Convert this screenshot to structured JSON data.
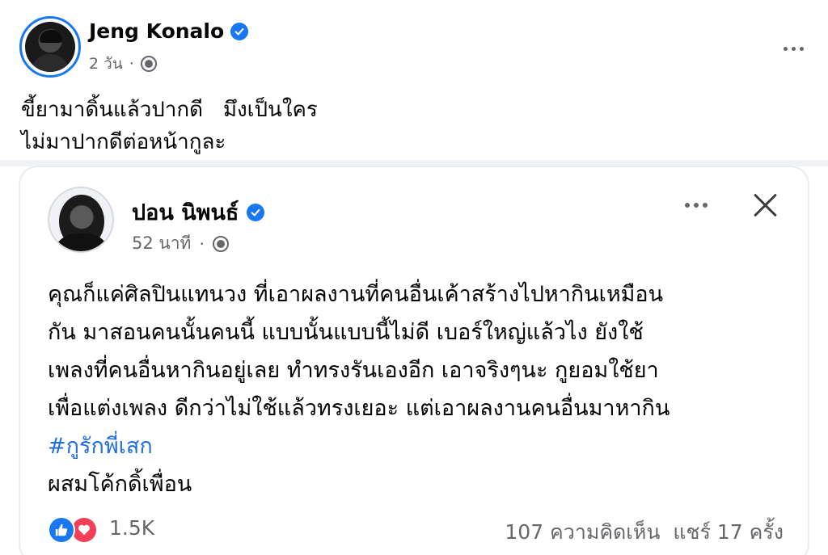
{
  "outer_post": {
    "author": "Jeng Konalo",
    "time": "2 วัน",
    "text_line1": "ขี้ยามาดิ้นแล้วปากดี   มึงเป็นใคร",
    "text_line2": "ไม่มาปากดีต่อหน้ากูละ",
    "icons": [
      "verified-badge-icon",
      "globe-icon",
      "more-options-icon"
    ]
  },
  "shared_post": {
    "author": "ปอน นิพนธ์",
    "time": "52 นาที",
    "body_lines": [
      "คุณก็แค่ศิลปินแทนวง ที่เอาผลงานที่คนอื่นเค้าสร้างไปหากินเหมือน",
      "กัน มาสอนคนนั้นคนนี้ แบบนั้นแบบนี้ไม่ดี เบอร์ใหญ่แล้วไง ยังใช้",
      "เพลงที่คนอื่นหากินอยู่เลย ทำทรงรันเองอีก เอาจริงๆนะ กูยอมใช้ยา",
      "เพื่อแต่งเพลง ดีกว่าไม่ใช้แล้วทรงเยอะ แต่เอาผลงานคนอื่นมาหากิน"
    ],
    "hashtag": "#กูรักพี่เสก",
    "last_line": "ผสมโค้กดิ้เพื่อน",
    "reaction_count": "1.5K",
    "comments": "107 ความคิดเห็น",
    "shares": "แชร์ 17 ครั้ง",
    "icons": [
      "verified-badge-icon",
      "globe-icon",
      "more-options-icon",
      "close-icon",
      "like-reaction-icon",
      "love-reaction-icon"
    ]
  },
  "colors": {
    "accent": "#1877f2",
    "love": "#f33e58",
    "secondary_text": "#65676b",
    "hashtag": "#216fdb"
  }
}
